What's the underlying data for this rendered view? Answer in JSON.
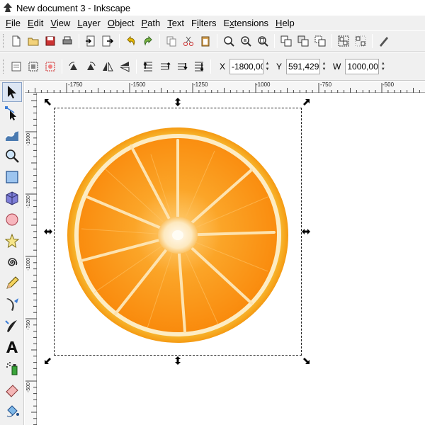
{
  "window": {
    "title": "New document 3 - Inkscape"
  },
  "menu": [
    {
      "label": "File",
      "key": "F",
      "rest": "ile"
    },
    {
      "label": "Edit",
      "key": "E",
      "rest": "dit"
    },
    {
      "label": "View",
      "key": "V",
      "rest": "iew"
    },
    {
      "label": "Layer",
      "key": "L",
      "rest": "ayer"
    },
    {
      "label": "Object",
      "key": "O",
      "rest": "bject"
    },
    {
      "label": "Path",
      "key": "P",
      "rest": "ath"
    },
    {
      "label": "Text",
      "key": "T",
      "rest": "ext"
    },
    {
      "label": "Filters",
      "key": "i",
      "pre": "F",
      "rest": "lters"
    },
    {
      "label": "Extensions",
      "key": "x",
      "pre": "E",
      "rest": "tensions"
    },
    {
      "label": "Help",
      "key": "H",
      "rest": "elp"
    }
  ],
  "coords": {
    "x_label": "X",
    "x_value": "-1800,00",
    "y_label": "Y",
    "y_value": "591,429",
    "w_label": "W",
    "w_value": "1000,00"
  },
  "ruler_h": [
    "-1750",
    "-1500",
    "-1250",
    "-1000",
    "-750",
    "-500"
  ],
  "ruler_v": [
    "-1500",
    "-1250",
    "-1000",
    "-750",
    "-500"
  ],
  "icons": {
    "toolbar": [
      "new-document-icon",
      "open-icon",
      "save-icon",
      "print-icon",
      "import-icon",
      "export-icon",
      "undo-icon",
      "redo-icon",
      "copy-icon",
      "cut-icon",
      "paste-icon",
      "zoom-selection-icon",
      "zoom-drawing-icon",
      "zoom-page-icon",
      "duplicate-icon",
      "clone-icon",
      "unlink-clone-icon",
      "group-icon",
      "ungroup-icon",
      "fill-stroke-icon"
    ],
    "tools": [
      "selector-tool-icon",
      "node-tool-icon",
      "tweak-tool-icon",
      "zoom-tool-icon",
      "rectangle-tool-icon",
      "3d-box-tool-icon",
      "ellipse-tool-icon",
      "star-tool-icon",
      "spiral-tool-icon",
      "pencil-tool-icon",
      "pen-tool-icon",
      "calligraphy-tool-icon",
      "text-tool-icon",
      "spray-tool-icon",
      "eraser-tool-icon",
      "paint-bucket-tool-icon"
    ]
  },
  "colors": {
    "accent": "#3a7bd5",
    "orange_rind": "#f59a12",
    "orange_flesh": "#fb8f0e"
  }
}
